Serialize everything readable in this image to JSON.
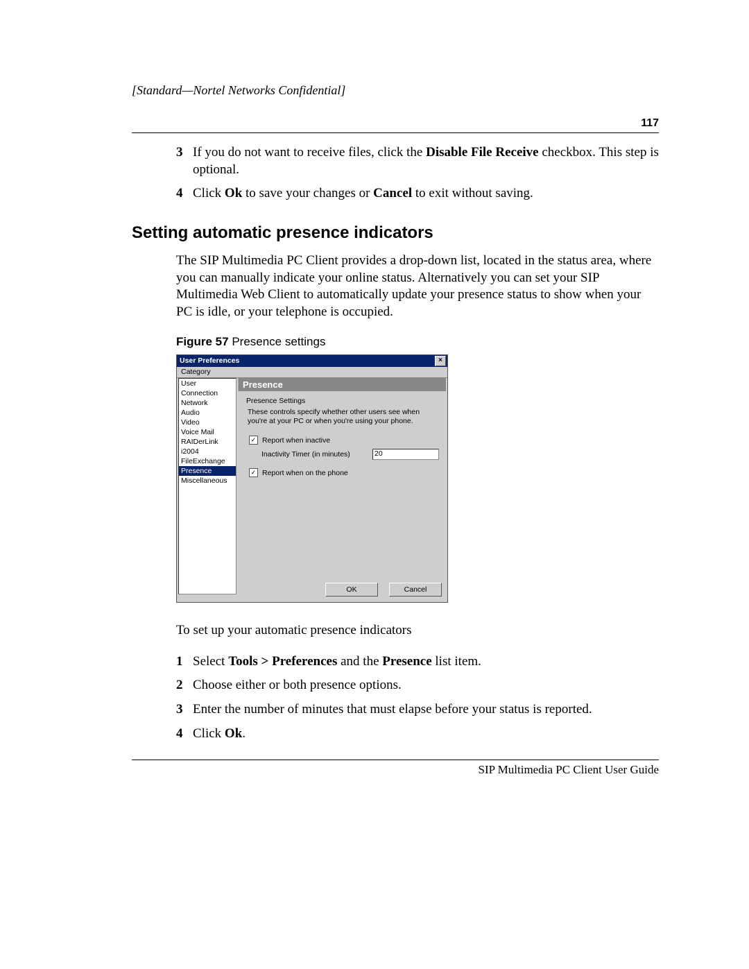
{
  "header": {
    "confidential": "[Standard—Nortel Networks Confidential]",
    "page_number": "117"
  },
  "top_steps": {
    "s3": {
      "num": "3",
      "pre": "If you do not want to receive files, click the ",
      "bold": "Disable File Receive",
      "post": " checkbox. This step is optional."
    },
    "s4": {
      "num": "4",
      "pre": "Click ",
      "bold1": "Ok",
      "mid": " to save your changes or ",
      "bold2": "Cancel",
      "post": " to exit without saving."
    }
  },
  "section": {
    "heading": "Setting automatic presence indicators",
    "para": "The SIP Multimedia PC Client provides a drop-down list, located in the status area, where you can manually indicate your online status. Alternatively you can set your SIP Multimedia Web Client to automatically update your presence status to show when your PC is idle, or your telephone is occupied."
  },
  "figure": {
    "label_bold": "Figure 57",
    "label_rest": "   Presence settings"
  },
  "dialog": {
    "title": "User Preferences",
    "close_glyph": "×",
    "category_label": "Category",
    "categories": [
      "User",
      "Connection",
      "Network",
      "Audio",
      "Video",
      "Voice Mail",
      "RAIDerLink",
      "i2004",
      "FileExchange",
      "Presence",
      "Miscellaneous"
    ],
    "selected_category": "Presence",
    "panel_title": "Presence",
    "group_legend": "Presence Settings",
    "description": "These controls specify whether other users see when you're at your PC or when you're using your phone.",
    "check_inactive": "Report when inactive",
    "check_inactive_mark": "✓",
    "inactivity_label": "Inactivity Timer (in minutes)",
    "inactivity_value": "20",
    "check_phone": "Report when on the phone",
    "check_phone_mark": "✓",
    "ok_label": "OK",
    "cancel_label": "Cancel"
  },
  "post_fig": {
    "intro": "To set up your automatic presence indicators",
    "s1": {
      "num": "1",
      "pre": "Select ",
      "b1": "Tools > Preferences",
      "mid": " and the ",
      "b2": "Presence",
      "post": " list item."
    },
    "s2": {
      "num": "2",
      "text": "Choose either or both presence options."
    },
    "s3": {
      "num": "3",
      "text": "Enter the number of minutes that must elapse before your status is reported."
    },
    "s4": {
      "num": "4",
      "pre": "Click ",
      "b1": "Ok",
      "post": "."
    }
  },
  "footer": "SIP Multimedia PC Client User Guide"
}
